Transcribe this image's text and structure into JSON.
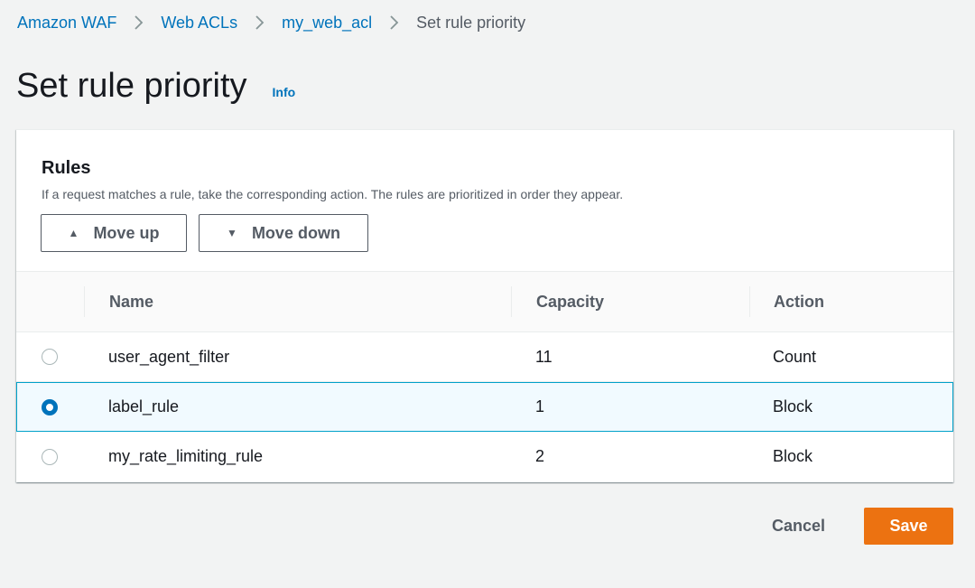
{
  "breadcrumb": {
    "items": [
      "Amazon WAF",
      "Web ACLs",
      "my_web_acl"
    ],
    "current": "Set rule priority"
  },
  "page": {
    "title": "Set rule priority",
    "info_label": "Info"
  },
  "panel": {
    "title": "Rules",
    "description": "If a request matches a rule, take the corresponding action. The rules are prioritized in order they appear.",
    "move_up_label": "Move up",
    "move_down_label": "Move down"
  },
  "table": {
    "columns": [
      "Name",
      "Capacity",
      "Action"
    ],
    "rows": [
      {
        "name": "user_agent_filter",
        "capacity": "11",
        "action": "Count",
        "selected": false
      },
      {
        "name": "label_rule",
        "capacity": "1",
        "action": "Block",
        "selected": true
      },
      {
        "name": "my_rate_limiting_rule",
        "capacity": "2",
        "action": "Block",
        "selected": false
      }
    ]
  },
  "footer": {
    "cancel_label": "Cancel",
    "save_label": "Save"
  },
  "colors": {
    "link": "#0073bb",
    "primary_button": "#ec7211",
    "selected_row_border": "#00a1c9",
    "selected_row_bg": "#f1faff"
  },
  "icons": {
    "separator": "chevron-right-icon",
    "move_up": "triangle-up-icon",
    "move_down": "triangle-down-icon"
  }
}
